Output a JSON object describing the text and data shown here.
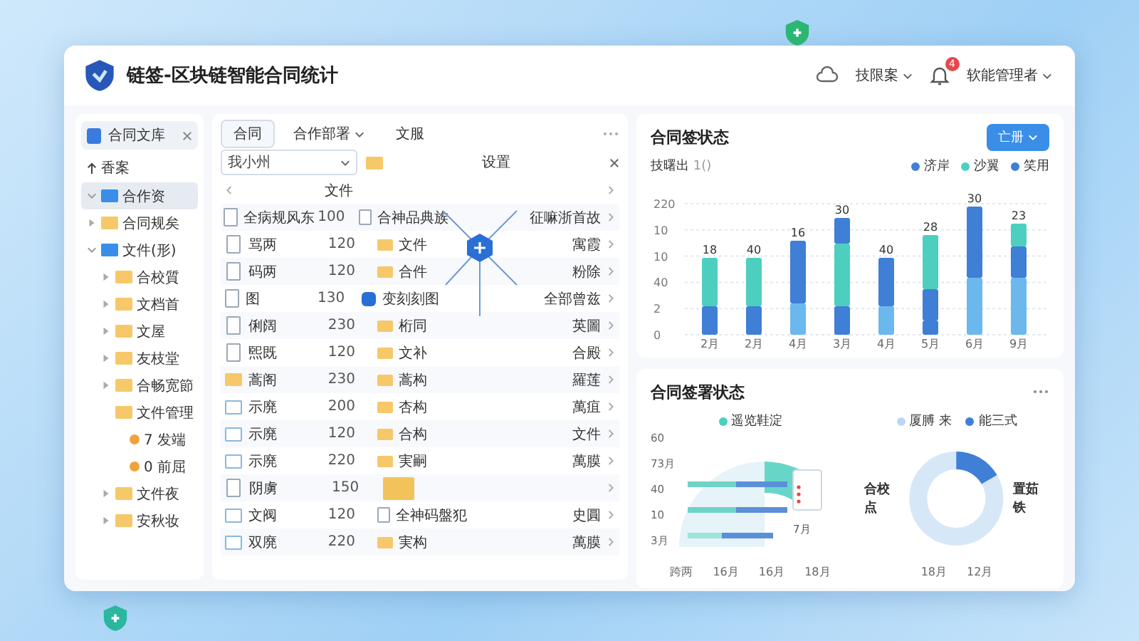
{
  "window": {
    "title": "链签-区块链智能合同统计"
  },
  "header": {
    "menu_label": "技限案",
    "user_label": "软能管理者",
    "notification_badge": "4"
  },
  "sidebar": {
    "tab_label": "合同文库",
    "back_label": "香案",
    "tree": [
      {
        "label": "合作资",
        "kind": "blue",
        "expanded": true,
        "selected": true
      },
      {
        "label": "合同规矣",
        "kind": "yellow",
        "expanded": false,
        "selected": false
      },
      {
        "label": "文件(形)",
        "kind": "blue",
        "expanded": true,
        "selected": false,
        "children": [
          {
            "label": "合校質",
            "kind": "yellow",
            "expanded": false,
            "selected": false
          },
          {
            "label": "文档首",
            "kind": "yellow",
            "expanded": false,
            "selected": false
          },
          {
            "label": "文屋",
            "kind": "yellow",
            "expanded": false,
            "selected": false
          },
          {
            "label": "友枝堂",
            "kind": "yellow",
            "expanded": false,
            "selected": false
          },
          {
            "label": "合畅宽節",
            "kind": "yellow",
            "expanded": false,
            "selected": false
          },
          {
            "label": "文件管理",
            "kind": "yellow",
            "selected": false,
            "children": [
              {
                "label": "7 发端",
                "kind": "leaf",
                "selected": false
              },
              {
                "label": "0 前屈",
                "kind": "leaf",
                "selected": false
              }
            ]
          },
          {
            "label": "文件夜",
            "kind": "yellow",
            "expanded": false,
            "selected": false
          },
          {
            "label": "安秋妆",
            "kind": "yellow",
            "expanded": false,
            "selected": false
          }
        ]
      }
    ]
  },
  "files": {
    "tabs": [
      {
        "label": "合同",
        "selected": true,
        "dropdown": false
      },
      {
        "label": "合作部署",
        "selected": false,
        "dropdown": true
      },
      {
        "label": "文服",
        "selected": false,
        "dropdown": false
      }
    ],
    "filter_value": "我小州",
    "settings_label": "设置",
    "header_label": "文件",
    "rows": [
      {
        "kind": "doc",
        "name": "全病规风东",
        "count": "100",
        "folder": {
          "kind": "doc",
          "label": "合神品典族"
        },
        "type": "征嘛浙首故"
      },
      {
        "kind": "doc",
        "name": "骂两",
        "count": "120",
        "folder": {
          "kind": "folder",
          "label": "文件"
        },
        "type": "寓霞"
      },
      {
        "kind": "doc",
        "name": "码两",
        "count": "120",
        "folder": {
          "kind": "folder",
          "label": "合件"
        },
        "type": "粉除"
      },
      {
        "kind": "doc",
        "name": "图",
        "count": "130",
        "folder": {
          "kind": "node",
          "label": "变刻刻图"
        },
        "type": "全部曾兹"
      },
      {
        "kind": "doc",
        "name": "俐阔",
        "count": "230",
        "folder": {
          "kind": "folder",
          "label": "桁同"
        },
        "type": "英圖"
      },
      {
        "kind": "doc",
        "name": "煕既",
        "count": "120",
        "folder": {
          "kind": "folder",
          "label": "文补"
        },
        "type": "合殿"
      },
      {
        "kind": "folder",
        "name": "蒿阁",
        "count": "230",
        "folder": {
          "kind": "folder",
          "label": "蒿构"
        },
        "type": "羅莲"
      },
      {
        "kind": "file",
        "name": "示廃",
        "count": "200",
        "folder": {
          "kind": "folder",
          "label": "杏构"
        },
        "type": "萬疽"
      },
      {
        "kind": "file",
        "name": "示廃",
        "count": "120",
        "folder": {
          "kind": "folder",
          "label": "合构"
        },
        "type": "文件"
      },
      {
        "kind": "file",
        "name": "示廃",
        "count": "220",
        "folder": {
          "kind": "folder",
          "label": "実嗣"
        },
        "type": "萬膜"
      },
      {
        "kind": "doc",
        "name": "阴虜",
        "count": "150",
        "folder": {
          "kind": "bigfolder"
        }
      },
      {
        "kind": "file",
        "name": "文阀",
        "count": "120",
        "folder": {
          "kind": "doc",
          "label": "全神码盤犯"
        },
        "type": "史圓"
      },
      {
        "kind": "file",
        "name": "双廃",
        "count": "220",
        "folder": {
          "kind": "folder",
          "label": "実构"
        },
        "type": "萬膜"
      }
    ]
  },
  "status_card": {
    "title": "合同签状态",
    "button_label": "亡册",
    "subtitle": "技曙出",
    "subtitle_unit": "1()",
    "legend": [
      {
        "label": "济岸",
        "color": "#3f7fd6"
      },
      {
        "label": "沙翼",
        "color": "#4ccfbf"
      },
      {
        "label": "笑用",
        "color": "#3f7fd6"
      }
    ],
    "y_tick_labels": [
      "220",
      "10",
      "10",
      "40",
      "2",
      "0"
    ],
    "bar_labels": [
      "18",
      "40",
      "16",
      "30",
      "40",
      "28",
      "30",
      "23"
    ],
    "x_labels": [
      "2月",
      "2月",
      "4月",
      "3月",
      "4月",
      "5月",
      "6月",
      "9月"
    ]
  },
  "sign_card": {
    "title": "合同签署状态",
    "left_legend": [
      {
        "label": "遥览鞋淀",
        "color": "#4ccfbf"
      }
    ],
    "left_y_labels": [
      "60",
      "73月",
      "40",
      "10",
      "3月"
    ],
    "left_x_labels": [
      "跨两",
      "16月",
      "16月",
      "18月"
    ],
    "left_note": "7月",
    "right_legend": [
      {
        "label": "厦膊 来",
        "color": "#bcd6f2"
      },
      {
        "label": "能三式",
        "color": "#3f7fd6"
      }
    ],
    "right_left_label": "合校点",
    "right_right_label": "置茹铁",
    "right_x_labels": [
      "18月",
      "12月"
    ]
  }
}
